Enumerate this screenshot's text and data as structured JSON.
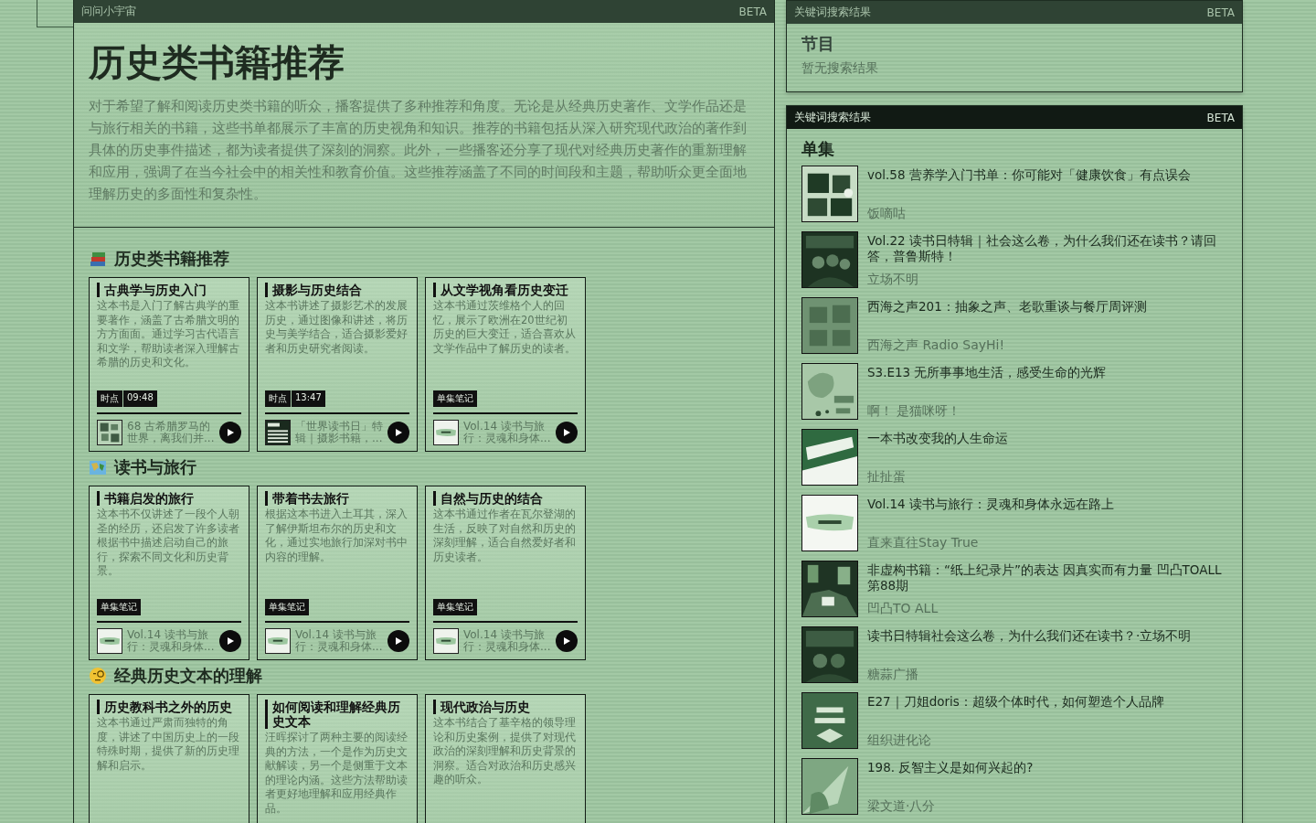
{
  "app": {
    "title": "问问小宇宙",
    "badge": "BETA"
  },
  "summary": {
    "heading": "历史类书籍推荐",
    "text": "对于希望了解和阅读历史类书籍的听众，播客提供了多种推荐和角度。无论是从经典历史著作、文学作品还是与旅行相关的书籍，这些书单都展示了丰富的历史视角和知识。推荐的书籍包括从深入研究现代政治的著作到具体的历史事件描述，都为读者提供了深刻的洞察。此外，一些播客还分享了现代对经典历史著作的重新理解和应用，强调了在当今社会中的相关性和教育价值。这些推荐涵盖了不同的时间段和主题，帮助听众更全面地理解历史的多面性和复杂性。"
  },
  "sections": [
    {
      "title": "历史类书籍推荐",
      "cards": [
        {
          "title": "古典学与历史入门",
          "description": "这本书是入门了解古典学的重要著作，涵盖了古希腊文明的方方面面。通过学习古代语言和文学，帮助读者深入理解古希腊的历史和文化。",
          "tags": [
            "时点",
            "09:48"
          ],
          "episode": {
            "title": "68 古希腊罗马的世界，离我们并..."
          }
        },
        {
          "title": "摄影与历史结合",
          "description": "这本书讲述了摄影艺术的发展历史，通过图像和讲述，将历史与美学结合，适合摄影爱好者和历史研究者阅读。",
          "tags": [
            "时点",
            "13:47"
          ],
          "episode": {
            "title": "「世界读书日」特辑｜摄影书籍，..."
          }
        },
        {
          "title": "从文学视角看历史变迁",
          "description": "这本书通过茨维格个人的回忆，展示了欧洲在20世纪初历史的巨大变迁，适合喜欢从文学作品中了解历史的读者。",
          "tags": [
            "单集笔记"
          ],
          "episode": {
            "title": "Vol.14 读书与旅行：灵魂和身体..."
          }
        }
      ]
    },
    {
      "title": "读书与旅行",
      "cards": [
        {
          "title": "书籍启发的旅行",
          "description": "这本书不仅讲述了一段个人朝圣的经历，还启发了许多读者根据书中描述启动自己的旅行，探索不同文化和历史背景。",
          "tags": [
            "单集笔记"
          ],
          "episode": {
            "title": "Vol.14 读书与旅行：灵魂和身体..."
          }
        },
        {
          "title": "带着书去旅行",
          "description": "根据这本书进入土耳其，深入了解伊斯坦布尔的历史和文化，通过实地旅行加深对书中内容的理解。",
          "tags": [
            "单集笔记"
          ],
          "episode": {
            "title": "Vol.14 读书与旅行：灵魂和身体..."
          }
        },
        {
          "title": "自然与历史的结合",
          "description": "这本书通过作者在瓦尔登湖的生活，反映了对自然和历史的深刻理解，适合自然爱好者和历史读者。",
          "tags": [
            "单集笔记"
          ],
          "episode": {
            "title": "Vol.14 读书与旅行：灵魂和身体..."
          }
        }
      ]
    },
    {
      "title": "经典历史文本的理解",
      "cards": [
        {
          "title": "历史教科书之外的历史",
          "description": "这本书通过严肃而独特的角度，讲述了中国历史上的一段特殊时期，提供了新的历史理解和启示。"
        },
        {
          "title": "如何阅读和理解经典历史文本",
          "description": "汪晖探讨了两种主要的阅读经典的方法，一个是作为历史文献解读，另一个是侧重于文本的理论内涵。这些方法帮助读者更好地理解和应用经典作品。"
        },
        {
          "title": "现代政治与历史",
          "description": "这本书结合了基辛格的领导理论和历史案例，提供了对现代政治的深刻理解和历史背景的洞察。适合对政治和历史感兴趣的听众。"
        }
      ]
    }
  ],
  "keyword_panels": [
    {
      "title": "关键词搜索结果",
      "badge": "BETA",
      "active": false,
      "heading": "节目",
      "empty": "暂无搜索结果"
    },
    {
      "title": "关键词搜索结果",
      "badge": "BETA",
      "active": true,
      "heading": "单集",
      "results": [
        {
          "title": "vol.58 营养学入门书单：你可能对「健康饮食」有点误会",
          "podcast": "饭嘀咕"
        },
        {
          "title": "Vol.22 读书日特辑｜社会这么卷，为什么我们还在读书？请回答，普鲁斯特！",
          "podcast": "立场不明"
        },
        {
          "title": "西海之声201：抽象之声、老歌重谈与餐厅周评测",
          "podcast": "西海之声 Radio SayHi!"
        },
        {
          "title": "S3.E13 无所事事地生活，感受生命的光辉",
          "podcast": "啊！ 是猫咪呀！"
        },
        {
          "title": "一本书改变我的人生命运",
          "podcast": "扯扯蛋"
        },
        {
          "title": "Vol.14 读书与旅行：灵魂和身体永远在路上",
          "podcast": "直来直往Stay True"
        },
        {
          "title": "非虚构书籍：“纸上纪录片”的表达 因真实而有力量 凹凸TOALL 第88期",
          "podcast": "凹凸TO ALL"
        },
        {
          "title": "读书日特辑社会这么卷，为什么我们还在读书？·立场不明",
          "podcast": "糖蒜广播"
        },
        {
          "title": "E27｜刀姐doris：超级个体时代，如何塑造个人品牌",
          "podcast": "组织进化论"
        },
        {
          "title": "198. 反智主义是如何兴起的?",
          "podcast": "梁文道·八分"
        }
      ]
    }
  ]
}
